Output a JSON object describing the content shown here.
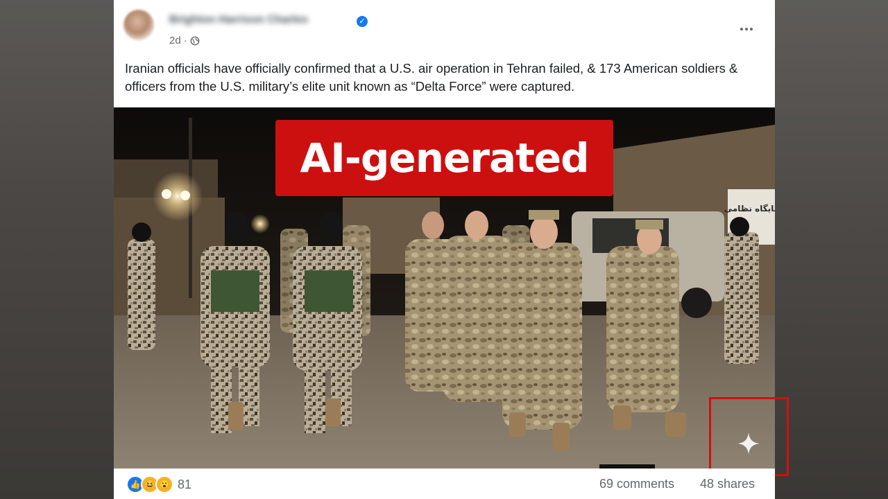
{
  "post": {
    "author": "Brighton Harrison Charles",
    "timestamp": "2d",
    "separator": "·",
    "visibility_icon": "globe-icon",
    "verified_icon": "verified-badge-icon",
    "more_icon": "more-options-icon",
    "text": "Iranian officials have officially confirmed that a U.S. air operation in Tehran failed, & 173 American soldiers & officers from the U.S. military’s elite unit known as “Delta Force” were captured."
  },
  "overlay": {
    "badge_label": "AI-generated",
    "badge_color": "#cc1010",
    "highlight_color": "#d30f0f",
    "watermark_icon": "sparkle-icon"
  },
  "photo": {
    "sign_text": "پایگاه نظامی"
  },
  "engagement": {
    "reaction_icons": [
      "like-icon",
      "haha-icon",
      "wow-icon"
    ],
    "reaction_count": "81",
    "comments": "69 comments",
    "shares": "48 shares"
  }
}
